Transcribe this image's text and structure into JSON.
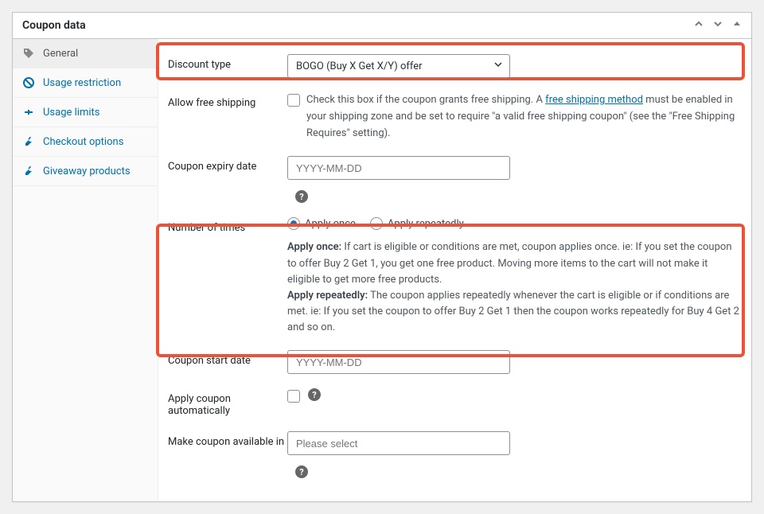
{
  "panel": {
    "title": "Coupon data"
  },
  "tabs": {
    "general": "General",
    "usage_restriction": "Usage restriction",
    "usage_limits": "Usage limits",
    "checkout_options": "Checkout options",
    "giveaway_products": "Giveaway products"
  },
  "fields": {
    "discount_type": {
      "label": "Discount type",
      "value": "BOGO (Buy X Get X/Y) offer"
    },
    "free_shipping": {
      "label": "Allow free shipping",
      "desc_before": "Check this box if the coupon grants free shipping. A ",
      "link_text": "free shipping method",
      "desc_after": " must be enabled in your shipping zone and be set to require \"a valid free shipping coupon\" (see the \"Free Shipping Requires\" setting)."
    },
    "expiry_date": {
      "label": "Coupon expiry date",
      "placeholder": "YYYY-MM-DD"
    },
    "number_times": {
      "label": "Number of times",
      "option_once": "Apply once",
      "option_repeat": "Apply repeatedly",
      "once_title": "Apply once:",
      "once_desc": " If cart is eligible or conditions are met, coupon applies once. ie: If you set the coupon to offer Buy 2 Get 1, you get one free product. Moving more items to the cart will not make it eligible to get more free products.",
      "repeat_title": "Apply repeatedly:",
      "repeat_desc": " The coupon applies repeatedly whenever the cart is eligible or if conditions are met. ie: If you set the coupon to offer Buy 2 Get 1 then the coupon works repeatedly for Buy 4 Get 2 and so on."
    },
    "start_date": {
      "label": "Coupon start date",
      "placeholder": "YYYY-MM-DD"
    },
    "apply_auto": {
      "label": "Apply coupon automatically"
    },
    "available_in": {
      "label": "Make coupon available in",
      "placeholder": "Please select"
    }
  }
}
